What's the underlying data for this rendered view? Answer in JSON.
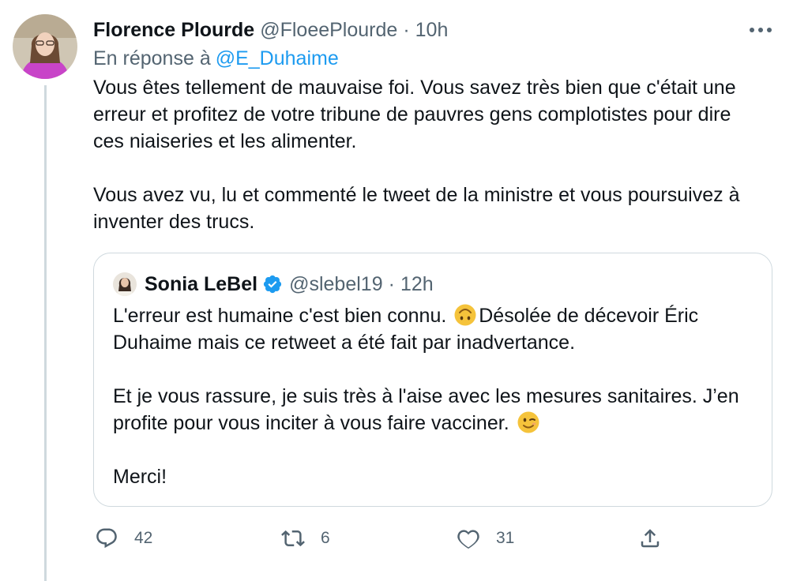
{
  "tweet": {
    "author_name": "Florence Plourde",
    "author_handle": "@FloeePlourde",
    "separator": "·",
    "time": "10h",
    "reply_prefix": "En réponse à",
    "reply_to": "@E_Duhaime",
    "body_lines": [
      "Vous êtes tellement de mauvaise foi. Vous savez très bien que c'était une",
      "erreur et profitez de votre tribune de pauvres gens complotistes pour dire",
      "ces niaiseries et les alimenter.",
      "Vous avez vu, lu et commenté le tweet de la ministre et vous poursuivez à",
      "inventer des trucs."
    ],
    "more_icon": "ellipsis-icon",
    "verified_icon": "verified-badge-icon"
  },
  "quoted": {
    "author_name": "Sonia LeBel",
    "author_handle": "@slebel19",
    "separator": "·",
    "time": "12h",
    "line1_before": "L'erreur est humaine c'est bien connu. ",
    "emoji1": "upside-down-face-emoji",
    "line1_after": "Désolée de décevoir Éric",
    "line2": "Duhaime mais ce retweet a été fait par inadvertance.",
    "line3": "Et je vous rassure, je suis très à l'aise avec les mesures sanitaires. J’en",
    "line4": "profite pour vous inciter à vous faire vacciner. ",
    "emoji2": "winking-face-emoji",
    "line5": "Merci!"
  },
  "actions": {
    "reply_count": "42",
    "retweet_count": "6",
    "like_count": "31",
    "icons": [
      "reply-icon",
      "retweet-icon",
      "like-icon",
      "share-icon"
    ]
  },
  "colors": {
    "text": "#0f1419",
    "secondary": "#536471",
    "link": "#1d9bf0",
    "border": "#cfd9de",
    "verified": "#1d9bf0",
    "emoji": "#f5c33b"
  }
}
